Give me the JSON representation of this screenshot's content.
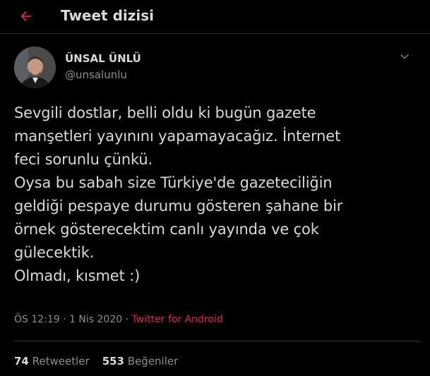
{
  "colors": {
    "background": "#000000",
    "text": "#d9d9d9",
    "secondary_text": "#8e8e8e",
    "accent": "#e0245e",
    "divider": "#2f3336"
  },
  "header": {
    "back_icon": "arrow-left-icon",
    "title": "Tweet dizisi"
  },
  "tweet": {
    "display_name": "ÜNSAL ÜNLÜ",
    "username": "@unsalunlu",
    "menu_icon": "chevron-down-icon",
    "text": "Sevgili dostlar, belli oldu ki bugün gazete\nmanşetleri yayınını yapamayacağız. İnternet\nfeci sorunlu çünkü.\nOysa bu sabah size Türkiye'de gazeteciliğin\ngeldiği pespaye durumu gösteren şahane bir\nörnek gösterecektim canlı yayında ve çok\ngülecektik.\nOlmadı, kısmet :)",
    "time": "ÖS 12:19",
    "date": "1 Nis 2020",
    "separator": "·",
    "source": "Twitter for Android",
    "retweets_count": "74",
    "retweets_label": "Retweetler",
    "likes_count": "553",
    "likes_label": "Beğeniler"
  }
}
